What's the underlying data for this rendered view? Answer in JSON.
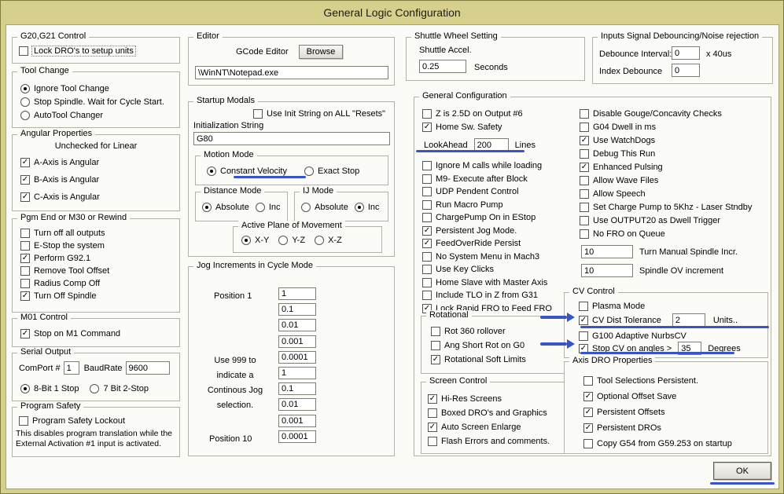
{
  "window": {
    "title": "General Logic Configuration",
    "ok_label": "OK"
  },
  "colors": {
    "frame": "#d7d08c",
    "dialog": "#fbfbf8",
    "annotation": "#3a53c9"
  },
  "left": {
    "g20": {
      "title": "G20,G21 Control",
      "checks": [
        {
          "label": "Lock DRO's to setup units",
          "checked": false,
          "focus": true
        }
      ]
    },
    "tool_change": {
      "title": "Tool Change",
      "radios": [
        {
          "label": "Ignore Tool Change",
          "selected": true
        },
        {
          "label": "Stop Spindle. Wait for Cycle Start.",
          "selected": false
        },
        {
          "label": "AutoTool Changer",
          "selected": false
        }
      ]
    },
    "angular": {
      "title": "Angular Properties",
      "note": "Unchecked for Linear",
      "checks": [
        {
          "label": "A-Axis is Angular",
          "checked": true
        },
        {
          "label": "B-Axis is Angular",
          "checked": true
        },
        {
          "label": "C-Axis is Angular",
          "checked": true
        }
      ]
    },
    "pgm_end": {
      "title": "Pgm End or M30 or Rewind",
      "checks": [
        {
          "label": "Turn off all outputs",
          "checked": false
        },
        {
          "label": "E-Stop the system",
          "checked": false
        },
        {
          "label": "Perform G92.1",
          "checked": true
        },
        {
          "label": "Remove Tool Offset",
          "checked": false
        },
        {
          "label": "Radius Comp Off",
          "checked": false
        },
        {
          "label": "Turn Off Spindle",
          "checked": true
        }
      ]
    },
    "m01": {
      "title": "M01 Control",
      "checks": [
        {
          "label": "Stop on M1 Command",
          "checked": true
        }
      ]
    },
    "serial": {
      "title": "Serial Output",
      "comport_label": "ComPort #",
      "comport_value": "1",
      "baud_label": "BaudRate",
      "baud_value": "9600",
      "radios": [
        {
          "label": "8-Bit 1 Stop",
          "selected": true
        },
        {
          "label": "7 Bit 2-Stop",
          "selected": false
        }
      ]
    },
    "program_safety": {
      "title": "Program Safety",
      "checks": [
        {
          "label": "Program Safety Lockout",
          "checked": false
        }
      ],
      "note": "This disables program translation while the External Activation #1 input is activated."
    }
  },
  "middle": {
    "editor": {
      "title": "Editor",
      "gcode_label": "GCode Editor",
      "browse_label": "Browse",
      "path_value": "\\WinNT\\Notepad.exe"
    },
    "startup": {
      "title": "Startup Modals",
      "init_check": {
        "label": "Use Init String on ALL  \"Resets\"",
        "checked": false
      },
      "init_label": "Initialization String",
      "init_value": "G80",
      "motion": {
        "title": "Motion Mode",
        "radios": [
          {
            "label": "Constant Velocity",
            "selected": true
          },
          {
            "label": "Exact Stop",
            "selected": false
          }
        ]
      },
      "distance": {
        "title": "Distance Mode",
        "radios": [
          {
            "label": "Absolute",
            "selected": true
          },
          {
            "label": "Inc",
            "selected": false
          }
        ]
      },
      "ij": {
        "title": "IJ Mode",
        "radios": [
          {
            "label": "Absolute",
            "selected": false
          },
          {
            "label": "Inc",
            "selected": true
          }
        ]
      },
      "plane": {
        "title": "Active Plane of Movement",
        "radios": [
          {
            "label": "X-Y",
            "selected": true
          },
          {
            "label": "Y-Z",
            "selected": false
          },
          {
            "label": "X-Z",
            "selected": false
          }
        ]
      }
    },
    "jog": {
      "title": "Jog Increments in Cycle Mode",
      "pos1_label": "Position 1",
      "pos10_label": "Position 10",
      "note": "Use 999 to\nindicate a\nContinous Jog\nselection.",
      "values": [
        "1",
        "0.1",
        "0.01",
        "0.001",
        "0.0001",
        "1",
        "0.1",
        "0.01",
        "0.001",
        "0.0001"
      ]
    }
  },
  "right": {
    "shuttle": {
      "title": "Shuttle Wheel Setting",
      "accel_label": "Shuttle Accel.",
      "accel_value": "0.25",
      "unit": "Seconds"
    },
    "debounce": {
      "title": "Inputs Signal Debouncing/Noise rejection",
      "interval_label": "Debounce Interval:",
      "interval_value": "0",
      "interval_unit": "x 40us",
      "index_label": "Index Debounce",
      "index_value": "0"
    },
    "general": {
      "title": "General Configuration",
      "col1_checks": [
        {
          "label": "Z is 2.5D on Output #6",
          "checked": false
        },
        {
          "label": "Home Sw. Safety",
          "checked": true
        }
      ],
      "lookahead": {
        "label": "LookAhead",
        "value": "200",
        "unit": "Lines"
      },
      "col1_checks2": [
        {
          "label": "Ignore M calls while loading",
          "checked": false
        },
        {
          "label": "M9- Execute after Block",
          "checked": false
        },
        {
          "label": "UDP Pendent Control",
          "checked": false
        },
        {
          "label": "Run Macro Pump",
          "checked": false
        },
        {
          "label": "ChargePump On in EStop",
          "checked": false
        },
        {
          "label": "Persistent Jog Mode.",
          "checked": true
        },
        {
          "label": "FeedOverRide Persist",
          "checked": true
        },
        {
          "label": "No System Menu in Mach3",
          "checked": false
        },
        {
          "label": "Use Key Clicks",
          "checked": false
        },
        {
          "label": "Home Slave with Master Axis",
          "checked": false
        },
        {
          "label": "Include TLO in Z from G31",
          "checked": false
        },
        {
          "label": "Lock Rapid FRO to Feed FRO",
          "checked": true
        }
      ],
      "rotational": {
        "title": "Rotational",
        "checks": [
          {
            "label": "Rot 360 rollover",
            "checked": false
          },
          {
            "label": "Ang Short Rot on G0",
            "checked": false
          },
          {
            "label": "Rotational Soft Limits",
            "checked": true
          }
        ]
      },
      "screen": {
        "title": "Screen Control",
        "checks": [
          {
            "label": "Hi-Res Screens",
            "checked": true
          },
          {
            "label": "Boxed DRO's and Graphics",
            "checked": false
          },
          {
            "label": "Auto Screen Enlarge",
            "checked": true
          },
          {
            "label": "Flash Errors and comments.",
            "checked": false
          }
        ]
      },
      "col2_checks": [
        {
          "label": "Disable Gouge/Concavity Checks",
          "checked": false
        },
        {
          "label": "G04 Dwell in ms",
          "checked": false
        },
        {
          "label": "Use WatchDogs",
          "checked": true
        },
        {
          "label": "Debug This Run",
          "checked": false
        },
        {
          "label": "Enhanced Pulsing",
          "checked": true
        },
        {
          "label": "Allow Wave Files",
          "checked": false
        },
        {
          "label": "Allow Speech",
          "checked": false
        },
        {
          "label": "Set Charge Pump to 5Khz - Laser Stndby",
          "checked": false
        },
        {
          "label": "Use OUTPUT20 as Dwell Trigger",
          "checked": false
        },
        {
          "label": "No FRO on Queue",
          "checked": false
        }
      ],
      "spindle_incr": {
        "value": "10",
        "label": "Turn Manual Spindle Incr."
      },
      "spindle_ov": {
        "value": "10",
        "label": "Spindle OV increment"
      },
      "cv": {
        "title": "CV Control",
        "plasma": {
          "label": "Plasma Mode",
          "checked": false
        },
        "cv_dist": {
          "label": "CV Dist Tolerance",
          "checked": true,
          "value": "2",
          "unit": "Units.."
        },
        "g100": {
          "label": "G100 Adaptive NurbsCV",
          "checked": false
        },
        "stop_cv": {
          "label": "Stop CV on angles >",
          "checked": true,
          "value": "35",
          "unit": "Degrees"
        }
      },
      "axis_dro": {
        "title": "Axis DRO Properties",
        "checks": [
          {
            "label": "Tool Selections Persistent.",
            "checked": false
          },
          {
            "label": "Optional Offset Save",
            "checked": true
          },
          {
            "label": "Persistent Offsets",
            "checked": true
          },
          {
            "label": "Persistent DROs",
            "checked": true
          },
          {
            "label": "Copy G54 from G59.253 on startup",
            "checked": false
          }
        ]
      }
    }
  }
}
